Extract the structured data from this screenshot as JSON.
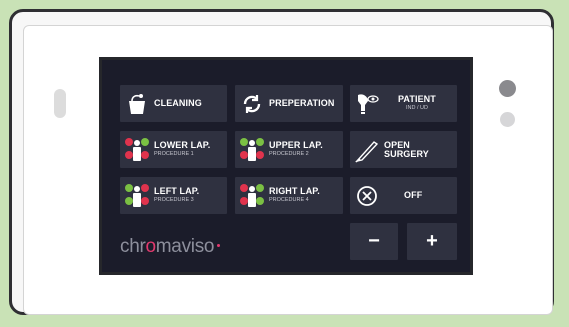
{
  "panel": {
    "logo": {
      "part1": "chr",
      "o": "o",
      "part2": "maviso"
    },
    "buttons": {
      "cleaning": {
        "label": "CLEANING",
        "icon": "bucket-icon"
      },
      "preparation": {
        "label": "PREPERATION",
        "icon": "refresh-icon"
      },
      "patient": {
        "label": "PATIENT",
        "sub": "IND / UD",
        "icon": "light-eye-icon"
      },
      "lower_lap": {
        "label": "LOWER LAP.",
        "sub": "PROCEDURE 1",
        "icon": "patient-lights-icon"
      },
      "upper_lap": {
        "label": "UPPER LAP.",
        "sub": "PROCEDURE 2",
        "icon": "patient-lights-icon"
      },
      "open_surgery": {
        "label": "OPEN SURGERY",
        "icon": "scalpel-icon"
      },
      "left_lap": {
        "label": "LEFT LAP.",
        "sub": "PROCEDURE 3",
        "icon": "patient-lights-icon"
      },
      "right_lap": {
        "label": "RIGHT LAP.",
        "sub": "PROCEDURE 4",
        "icon": "patient-lights-icon"
      },
      "off": {
        "label": "OFF",
        "icon": "close-circle-icon"
      },
      "minus": {
        "label": "−"
      },
      "plus": {
        "label": "+"
      }
    },
    "colors": {
      "screen": "#1b1c2a",
      "button": "#2f3140",
      "red": "#e0334d",
      "green": "#7bc043",
      "accent": "#e23a6e"
    }
  }
}
